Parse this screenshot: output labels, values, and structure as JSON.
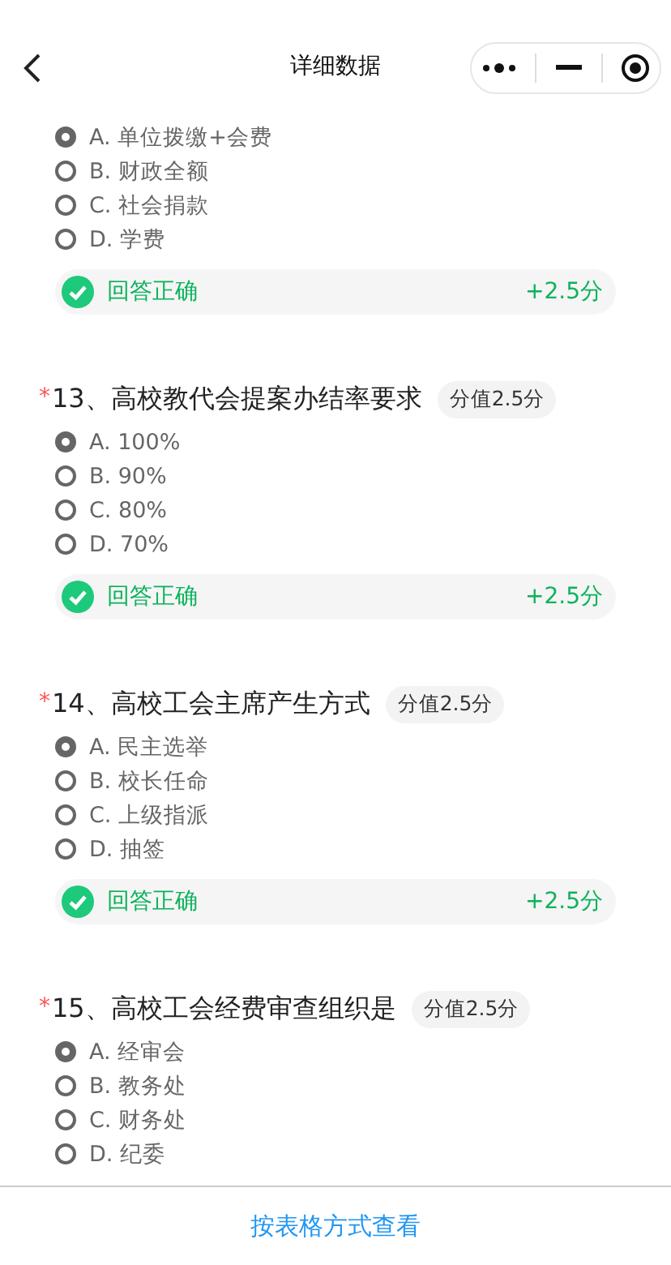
{
  "header": {
    "title": "详细数据"
  },
  "questions": [
    {
      "options": [
        {
          "label": "A. 单位拨缴+会费",
          "selected": true
        },
        {
          "label": "B. 财政全额",
          "selected": false
        },
        {
          "label": "C. 社会捐款",
          "selected": false
        },
        {
          "label": "D. 学费",
          "selected": false
        }
      ],
      "result": {
        "text": "回答正确",
        "points": "+2.5分"
      }
    },
    {
      "required_mark": "*",
      "title": "13、高校教代会提案办结率要求",
      "score": "分值2.5分",
      "options": [
        {
          "label": "A. 100%",
          "selected": true
        },
        {
          "label": "B. 90%",
          "selected": false
        },
        {
          "label": "C. 80%",
          "selected": false
        },
        {
          "label": "D. 70%",
          "selected": false
        }
      ],
      "result": {
        "text": "回答正确",
        "points": "+2.5分"
      }
    },
    {
      "required_mark": "*",
      "title": "14、高校工会主席产生方式",
      "score": "分值2.5分",
      "options": [
        {
          "label": "A. 民主选举",
          "selected": true
        },
        {
          "label": "B. 校长任命",
          "selected": false
        },
        {
          "label": "C. 上级指派",
          "selected": false
        },
        {
          "label": "D. 抽签",
          "selected": false
        }
      ],
      "result": {
        "text": "回答正确",
        "points": "+2.5分"
      }
    },
    {
      "required_mark": "*",
      "title": "15、高校工会经费审查组织是",
      "score": "分值2.5分",
      "options": [
        {
          "label": "A. 经审会",
          "selected": true
        },
        {
          "label": "B. 教务处",
          "selected": false
        },
        {
          "label": "C. 财务处",
          "selected": false
        },
        {
          "label": "D. 纪委",
          "selected": false
        }
      ]
    }
  ],
  "footer": {
    "link": "按表格方式查看"
  }
}
